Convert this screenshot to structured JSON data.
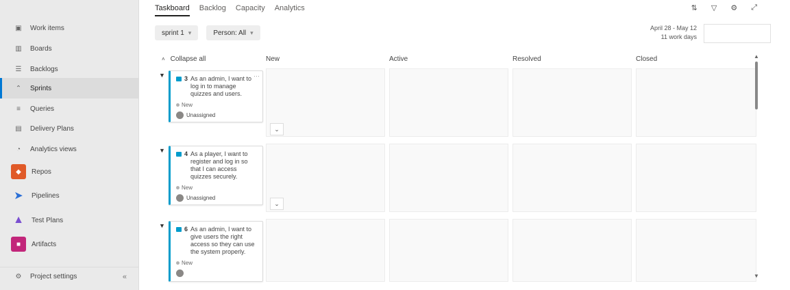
{
  "sidebar": {
    "items": [
      {
        "label": "Work items",
        "icon": "work-items-icon",
        "glyph": "▣",
        "color": "#666666"
      },
      {
        "label": "Boards",
        "icon": "boards-icon",
        "glyph": "▥",
        "color": "#666666"
      },
      {
        "label": "Backlogs",
        "icon": "backlogs-icon",
        "glyph": "☰",
        "color": "#666666"
      },
      {
        "label": "Sprints",
        "icon": "sprints-icon",
        "glyph": "⌃",
        "color": "#666666"
      },
      {
        "label": "Queries",
        "icon": "queries-icon",
        "glyph": "≡",
        "color": "#666666"
      },
      {
        "label": "Delivery Plans",
        "icon": "delivery-plans-icon",
        "glyph": "▤",
        "color": "#666666"
      },
      {
        "label": "Analytics views",
        "icon": "analytics-views-icon",
        "glyph": "◔",
        "color": "#666666"
      },
      {
        "label": "Repos",
        "icon": "repos-icon",
        "glyph": "◆",
        "color": "#e05a28"
      },
      {
        "label": "Pipelines",
        "icon": "pipelines-icon",
        "glyph": "➤",
        "color": "#2a6fd6"
      },
      {
        "label": "Test Plans",
        "icon": "test-plans-icon",
        "glyph": "▲",
        "color": "#7a4fd0"
      },
      {
        "label": "Artifacts",
        "icon": "artifacts-icon",
        "glyph": "■",
        "color": "#c2267a"
      }
    ],
    "active_index": 3,
    "bottom": {
      "label": "Project settings",
      "icon": "gear-icon",
      "collapse_icon": "chevron-left-icon"
    }
  },
  "tabs": [
    {
      "label": "Taskboard",
      "selected": true
    },
    {
      "label": "Backlog",
      "selected": false
    },
    {
      "label": "Capacity",
      "selected": false
    },
    {
      "label": "Analytics",
      "selected": false
    }
  ],
  "toolbar_icons": [
    "filter-settings-icon",
    "filter-icon",
    "settings-icon",
    "fullscreen-icon"
  ],
  "filters": {
    "sprint": "sprint 1",
    "person": "Person: All"
  },
  "dates": {
    "range": "April 28 - May 12",
    "work_days": "11 work days"
  },
  "board": {
    "collapse_all": "Collapse all",
    "columns": [
      "New",
      "Active",
      "Resolved",
      "Closed"
    ],
    "rows": [
      {
        "id": "3",
        "title": "As an admin, I want to log in to manage quizzes and users.",
        "state": "New",
        "assignee": "Unassigned"
      },
      {
        "id": "4",
        "title": "As a player, I want to register and log in so that I can access quizzes securely.",
        "state": "New",
        "assignee": "Unassigned"
      },
      {
        "id": "6",
        "title": "As an admin, I want to give users the right access so they can use the system properly.",
        "state": "New",
        "assignee": ""
      }
    ]
  },
  "colors": {
    "accent": "#0078d4",
    "story": "#009ccc"
  }
}
